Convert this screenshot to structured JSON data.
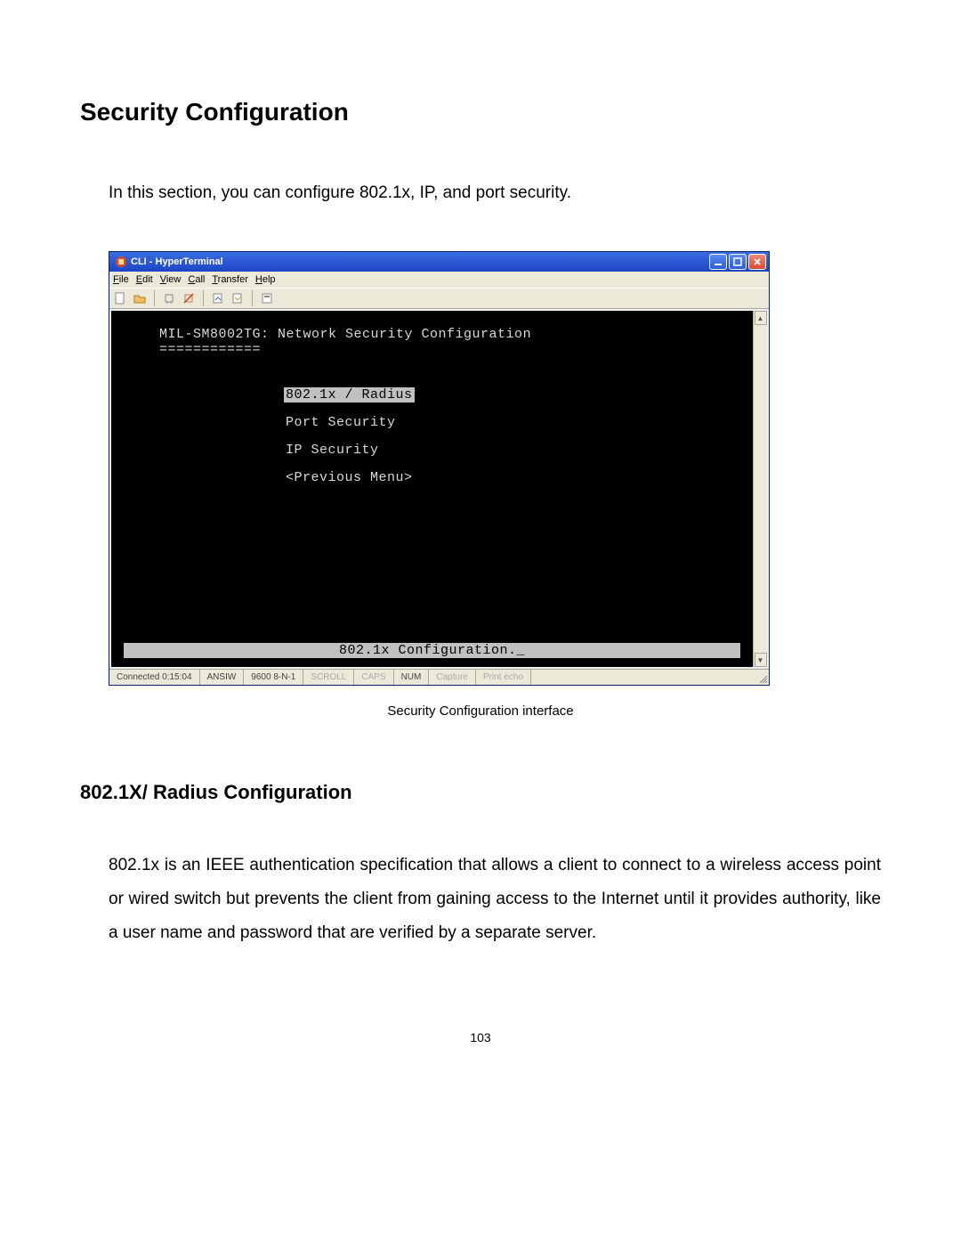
{
  "doc": {
    "section_title": "Security Configuration",
    "intro": "In this section, you can configure 802.1x, IP, and port security.",
    "caption": "Security Configuration interface",
    "subsection_title": "802.1X/ Radius Configuration",
    "body": "802.1x is an IEEE authentication specification that allows a client to connect to a wireless access point or wired switch but prevents the client from gaining access to the Internet until it provides authority, like a user name and password that are verified by a separate server.",
    "page_number": "103"
  },
  "window": {
    "title": "CLI - HyperTerminal",
    "menu": [
      "File",
      "Edit",
      "View",
      "Call",
      "Transfer",
      "Help"
    ],
    "toolbar_icons": [
      "new-icon",
      "open-icon",
      "connect-icon",
      "disconnect-icon",
      "send-icon",
      "receive-icon",
      "properties-icon"
    ]
  },
  "terminal": {
    "title_line": "MIL-SM8002TG: Network Security Configuration",
    "underline": "============",
    "menu_items": [
      {
        "label": "802.1x / Radius",
        "selected": true
      },
      {
        "label": "Port Security",
        "selected": false
      },
      {
        "label": "IP Security",
        "selected": false
      },
      {
        "label": "<Previous Menu>",
        "selected": false
      }
    ],
    "status_line": "802.1x Configuration._"
  },
  "statusbar": {
    "connected": "Connected 0:15:04",
    "emulation": "ANSIW",
    "settings": "9600 8-N-1",
    "scroll": "SCROLL",
    "caps": "CAPS",
    "num": "NUM",
    "capture": "Capture",
    "echo": "Print echo"
  }
}
